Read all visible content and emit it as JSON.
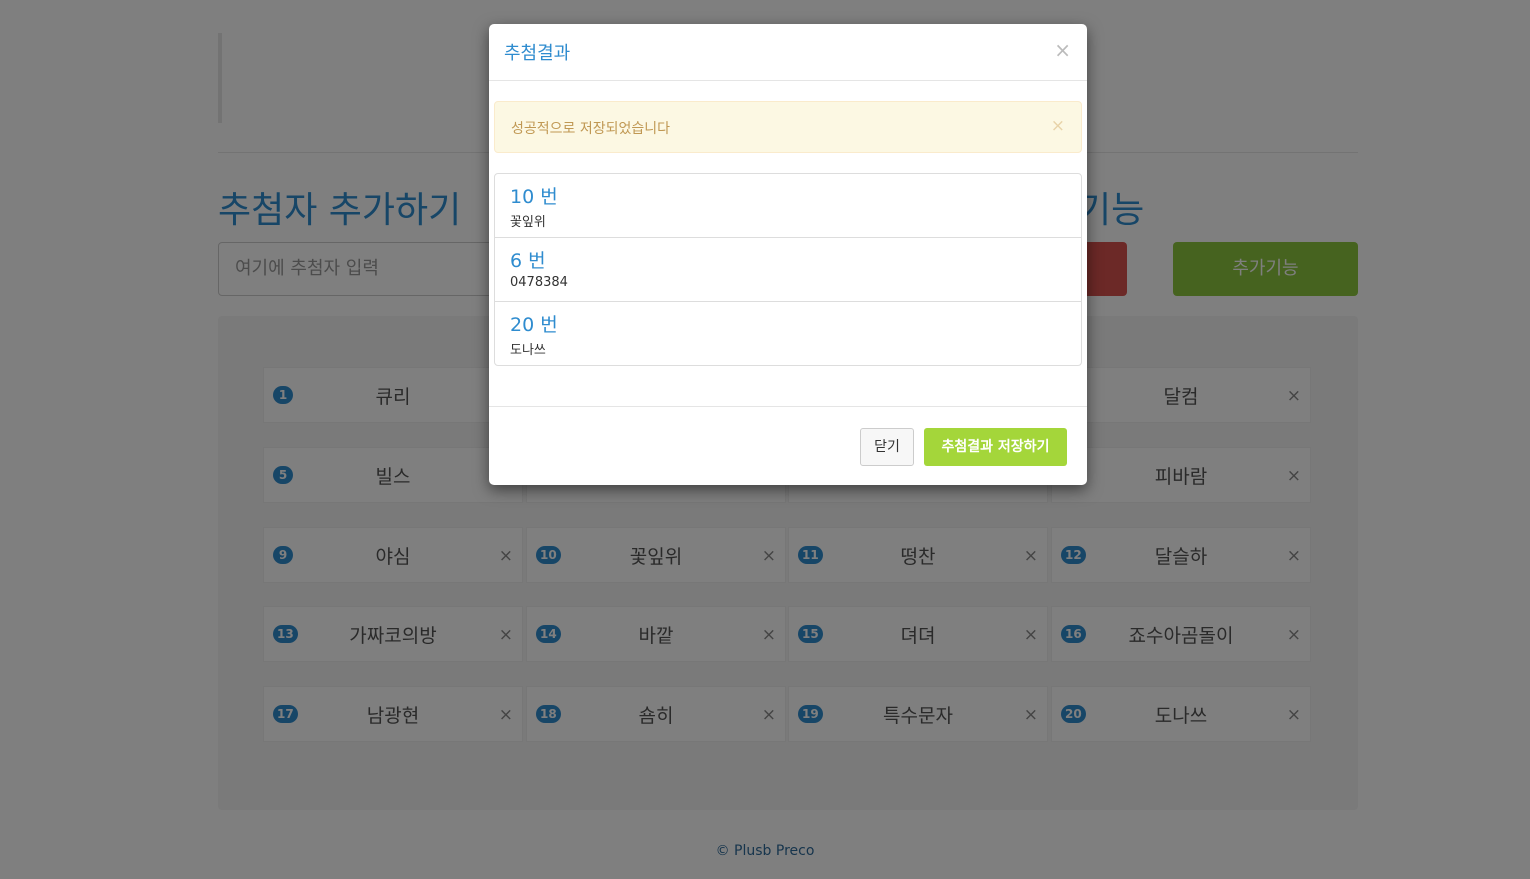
{
  "page": {
    "section_title_left": "추첨자 추가하기",
    "section_title_right": "기능",
    "add_input_placeholder": "여기에 추첨자 입력",
    "extra_button_label": "추가기능",
    "footer": "© Plusb Preco"
  },
  "participants": [
    {
      "num": "1",
      "name": "큐리"
    },
    {
      "num": "",
      "name": ""
    },
    {
      "num": "",
      "name": ""
    },
    {
      "num": "",
      "name": "달컴"
    },
    {
      "num": "5",
      "name": "빌스"
    },
    {
      "num": "",
      "name": ""
    },
    {
      "num": "",
      "name": ""
    },
    {
      "num": "",
      "name": "피바람"
    },
    {
      "num": "9",
      "name": "야심"
    },
    {
      "num": "10",
      "name": "꽃잎위"
    },
    {
      "num": "11",
      "name": "떵찬"
    },
    {
      "num": "12",
      "name": "달슬하"
    },
    {
      "num": "13",
      "name": "가짜코의방"
    },
    {
      "num": "14",
      "name": "바깥"
    },
    {
      "num": "15",
      "name": "뎌뎌"
    },
    {
      "num": "16",
      "name": "죠수아곰돌이"
    },
    {
      "num": "17",
      "name": "남광현"
    },
    {
      "num": "18",
      "name": "숌히"
    },
    {
      "num": "19",
      "name": "특수문자"
    },
    {
      "num": "20",
      "name": "도나쓰"
    }
  ],
  "card_close_glyph": "×",
  "modal": {
    "title": "추첨결과",
    "close_glyph": "×",
    "alert_text": "성공적으로 저장되었습니다",
    "alert_close_glyph": "×",
    "results": [
      {
        "number": "10 번",
        "name": "꽃잎위"
      },
      {
        "number": "6 번",
        "name": "0478384"
      },
      {
        "number": "20 번",
        "name": "도나쓰"
      }
    ],
    "close_button": "닫기",
    "save_button": "추첨결과 저장하기"
  }
}
